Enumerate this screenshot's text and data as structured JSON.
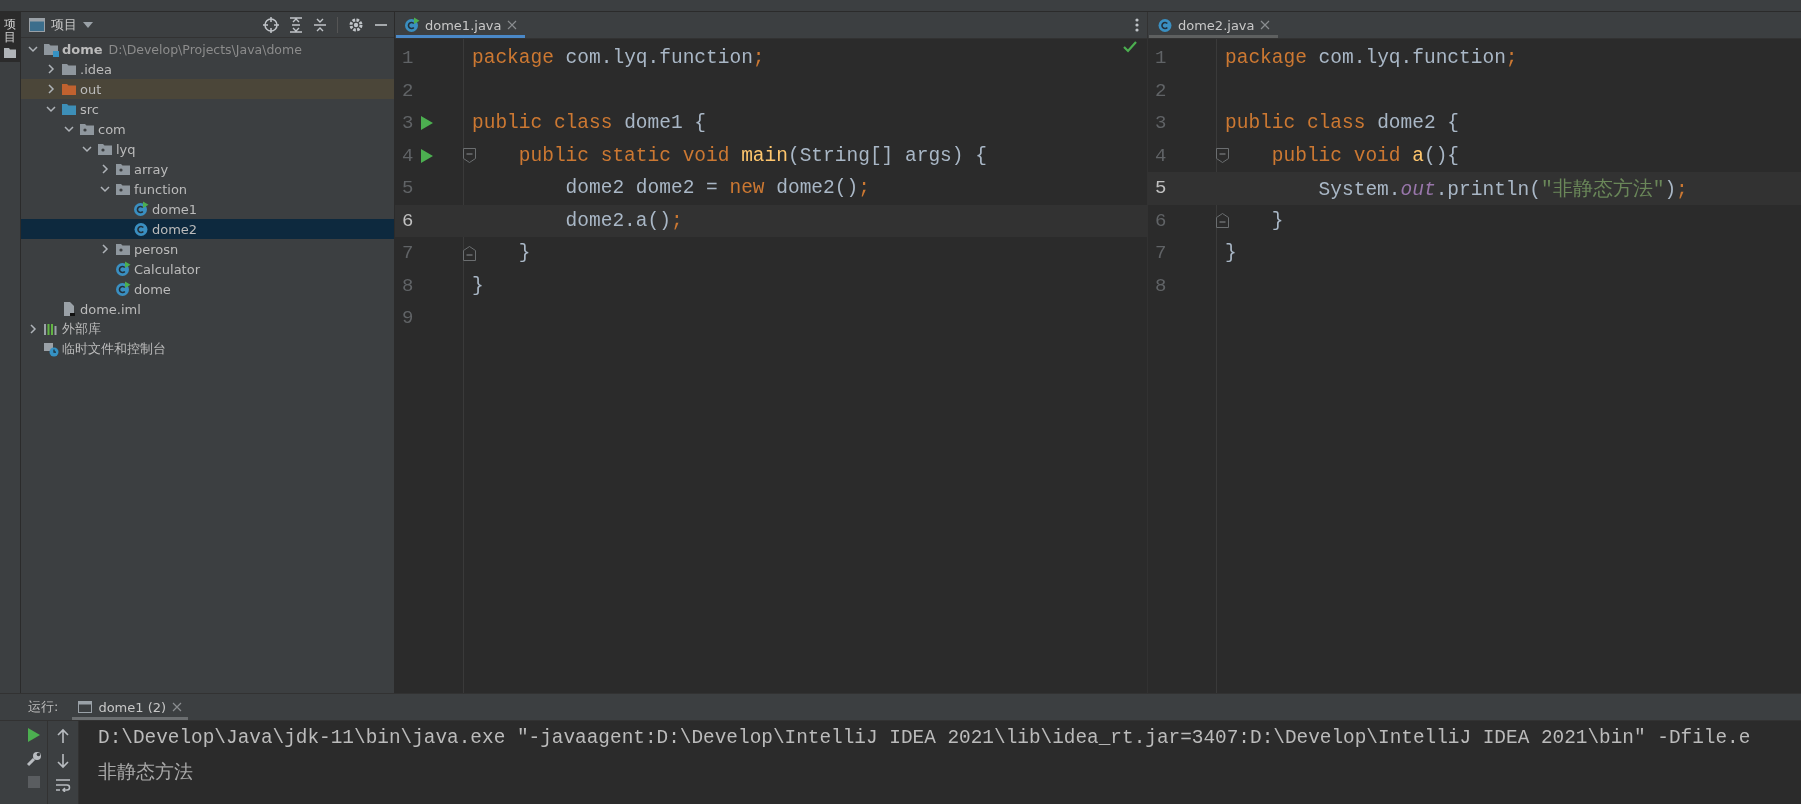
{
  "tool_strip": [
    {
      "label": "项目",
      "selected": true
    }
  ],
  "project_panel": {
    "title": "项目",
    "tree": [
      {
        "label": "dome",
        "path": "D:\\Develop\\Projects\\Java\\dome",
        "kind": "module",
        "expanded": true,
        "selected": false,
        "children": [
          {
            "label": ".idea",
            "kind": "folder",
            "expanded": false,
            "selected": false
          },
          {
            "label": "out",
            "kind": "excluded",
            "expanded": false,
            "selected": false
          },
          {
            "label": "src",
            "kind": "source",
            "expanded": true,
            "selected": false,
            "children": [
              {
                "label": "com",
                "kind": "package",
                "expanded": true,
                "selected": false,
                "children": [
                  {
                    "label": "lyq",
                    "kind": "package",
                    "expanded": true,
                    "selected": false,
                    "children": [
                      {
                        "label": "array",
                        "kind": "package",
                        "expanded": false,
                        "selected": false
                      },
                      {
                        "label": "function",
                        "kind": "package",
                        "expanded": true,
                        "selected": false,
                        "children": [
                          {
                            "label": "dome1",
                            "kind": "class-main",
                            "selected": false
                          },
                          {
                            "label": "dome2",
                            "kind": "class",
                            "selected": true
                          }
                        ]
                      },
                      {
                        "label": "perosn",
                        "kind": "package",
                        "expanded": false,
                        "selected": false
                      },
                      {
                        "label": "Calculator",
                        "kind": "class-main",
                        "selected": false
                      },
                      {
                        "label": "dome",
                        "kind": "class-main",
                        "selected": false
                      }
                    ]
                  }
                ]
              }
            ]
          },
          {
            "label": "dome.iml",
            "kind": "file",
            "selected": false
          }
        ]
      },
      {
        "label": "外部库",
        "kind": "library",
        "expanded": false,
        "selected": false
      },
      {
        "label": "临时文件和控制台",
        "kind": "scratches",
        "selected": false
      }
    ]
  },
  "editors": [
    {
      "tab": {
        "label": "dome1.java",
        "kind": "class-main",
        "selected": true
      },
      "no_problems": true,
      "lines": [
        {
          "number": "1",
          "current": false,
          "run": false,
          "fold_start": false,
          "fold_end": false,
          "tokens": [
            {
              "text": "package",
              "kind": "keyword"
            },
            {
              "text": " com.lyq.function",
              "kind": "plain"
            },
            {
              "text": ";",
              "kind": "punct"
            }
          ]
        },
        {
          "number": "2",
          "current": false,
          "run": false,
          "fold_start": false,
          "fold_end": false
        },
        {
          "number": "3",
          "current": false,
          "run": true,
          "fold_start": false,
          "fold_end": false,
          "tokens": [
            {
              "text": "public class",
              "kind": "keyword"
            },
            {
              "text": " dome1 {",
              "kind": "plain"
            }
          ]
        },
        {
          "number": "4",
          "current": false,
          "run": true,
          "fold_start": true,
          "fold_end": false,
          "tokens": [
            {
              "text": "    public static void ",
              "kind": "keyword"
            },
            {
              "text": "main",
              "kind": "method"
            },
            {
              "text": "(String[] args) {",
              "kind": "plain"
            }
          ]
        },
        {
          "number": "5",
          "current": false,
          "run": false,
          "fold_start": false,
          "fold_end": false,
          "tokens": [
            {
              "text": "        dome2 dome2 = ",
              "kind": "plain"
            },
            {
              "text": "new",
              "kind": "keyword"
            },
            {
              "text": " dome2()",
              "kind": "plain"
            },
            {
              "text": ";",
              "kind": "punct"
            }
          ]
        },
        {
          "number": "6",
          "current": true,
          "run": false,
          "fold_start": false,
          "fold_end": false,
          "tokens": [
            {
              "text": "        dome2.a()",
              "kind": "plain"
            },
            {
              "text": ";",
              "kind": "punct"
            }
          ]
        },
        {
          "number": "7",
          "current": false,
          "run": false,
          "fold_start": false,
          "fold_end": true,
          "tokens": [
            {
              "text": "    }",
              "kind": "plain"
            }
          ]
        },
        {
          "number": "8",
          "current": false,
          "run": false,
          "fold_start": false,
          "fold_end": false,
          "tokens": [
            {
              "text": "}",
              "kind": "plain"
            }
          ]
        },
        {
          "number": "9",
          "current": false,
          "run": false,
          "fold_start": false,
          "fold_end": false
        }
      ]
    },
    {
      "tab": {
        "label": "dome2.java",
        "kind": "class",
        "selected": false
      },
      "no_problems": false,
      "lines": [
        {
          "number": "1",
          "current": false,
          "run": false,
          "fold_start": false,
          "fold_end": false,
          "tokens": [
            {
              "text": "package",
              "kind": "keyword"
            },
            {
              "text": " com.lyq.function",
              "kind": "plain"
            },
            {
              "text": ";",
              "kind": "punct"
            }
          ]
        },
        {
          "number": "2",
          "current": false,
          "run": false,
          "fold_start": false,
          "fold_end": false
        },
        {
          "number": "3",
          "current": false,
          "run": false,
          "fold_start": false,
          "fold_end": false,
          "tokens": [
            {
              "text": "public class",
              "kind": "keyword"
            },
            {
              "text": " dome2 {",
              "kind": "plain"
            }
          ]
        },
        {
          "number": "4",
          "current": false,
          "run": false,
          "fold_start": true,
          "fold_end": false,
          "tokens": [
            {
              "text": "    public void ",
              "kind": "keyword"
            },
            {
              "text": "a",
              "kind": "method"
            },
            {
              "text": "(){",
              "kind": "plain"
            }
          ]
        },
        {
          "number": "5",
          "current": true,
          "run": false,
          "fold_start": false,
          "fold_end": false,
          "tokens": [
            {
              "text": "        System.",
              "kind": "plain"
            },
            {
              "text": "out",
              "kind": "field"
            },
            {
              "text": ".println(",
              "kind": "plain"
            },
            {
              "text": "\"非静态方法\"",
              "kind": "string"
            },
            {
              "text": ")",
              "kind": "plain"
            },
            {
              "text": ";",
              "kind": "punct"
            }
          ]
        },
        {
          "number": "6",
          "current": false,
          "run": false,
          "fold_start": false,
          "fold_end": true,
          "tokens": [
            {
              "text": "    }",
              "kind": "plain"
            }
          ]
        },
        {
          "number": "7",
          "current": false,
          "run": false,
          "fold_start": false,
          "fold_end": false,
          "tokens": [
            {
              "text": "}",
              "kind": "plain"
            }
          ]
        },
        {
          "number": "8",
          "current": false,
          "run": false,
          "fold_start": false,
          "fold_end": false
        }
      ]
    }
  ],
  "run_panel": {
    "label": "运行:",
    "tabs": [
      {
        "label": "dome1 (2)",
        "selected": true
      }
    ],
    "output": [
      {
        "text": "D:\\Develop\\Java\\jdk-11\\bin\\java.exe \"-javaagent:D:\\Develop\\IntelliJ IDEA 2021\\lib\\idea_rt.jar=3407:D:\\Develop\\IntelliJ IDEA 2021\\bin\" -Dfile.e",
        "kind": "command"
      },
      {
        "text": "非静态方法",
        "kind": "stdout"
      }
    ]
  }
}
